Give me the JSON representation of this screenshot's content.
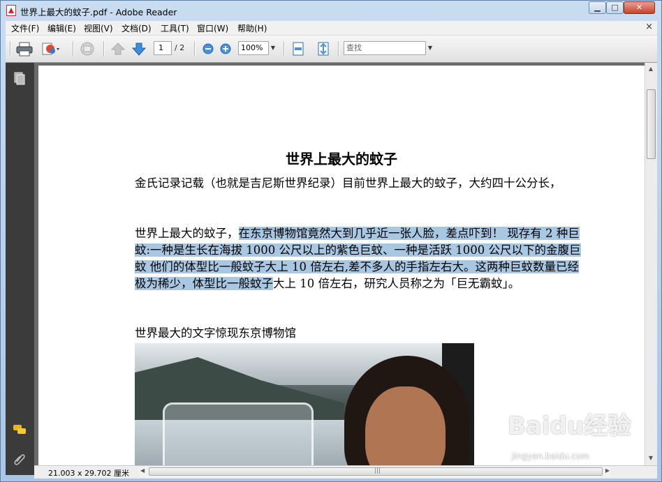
{
  "window": {
    "title": "世界上最大的蚊子.pdf - Adobe Reader",
    "min_label": "▁",
    "max_label": "□",
    "close_label": "✕"
  },
  "menu": {
    "items": [
      "文件(F)",
      "编辑(E)",
      "视图(V)",
      "文档(D)",
      "工具(T)",
      "窗口(W)",
      "帮助(H)"
    ],
    "close_doc": "×"
  },
  "toolbar": {
    "page_current": "1",
    "page_total": "/ 2",
    "zoom": "100%",
    "search_placeholder": "查找",
    "icons": [
      "print-icon",
      "export-icon",
      "collaborate-icon",
      "prev-page-icon",
      "next-page-icon",
      "zoom-out-icon",
      "zoom-in-icon",
      "fit-width-icon",
      "fit-page-icon"
    ]
  },
  "left_panel": {
    "icons": [
      "pages-icon",
      "comments-icon",
      "attachments-icon"
    ]
  },
  "document": {
    "title": "世界上最大的蚊子",
    "para1": "金氏记录记载（也就是吉尼斯世界纪录）目前世界上最大的蚊子，大约四十公分长，",
    "para2_plain_start": "世界上最大的蚊子，",
    "para2_highlight": "在东京博物馆竟然大到几乎近一张人脸，差点吓到！ 现存有 2 种巨蚊:一种是生长在海拔 1000 公尺以上的紫色巨蚊、一种是活跃 1000 公尺以下的金腹巨蚊 他们的体型比一般蚊子大上 10 倍左右,差不多人的手指左右大。这两种巨蚊数量已经极为稀少，体型比一般蚊子",
    "para2_plain_end": "大上 10 倍左右，研究人员称之为「巨无霸蚊」。",
    "para3": "世界最大的文字惊现东京博物馆"
  },
  "status": {
    "page_size": "21.003 x 29.702 厘米"
  },
  "watermark": {
    "logo": "Baidu经验",
    "url": "jingyan.baidu.com"
  }
}
